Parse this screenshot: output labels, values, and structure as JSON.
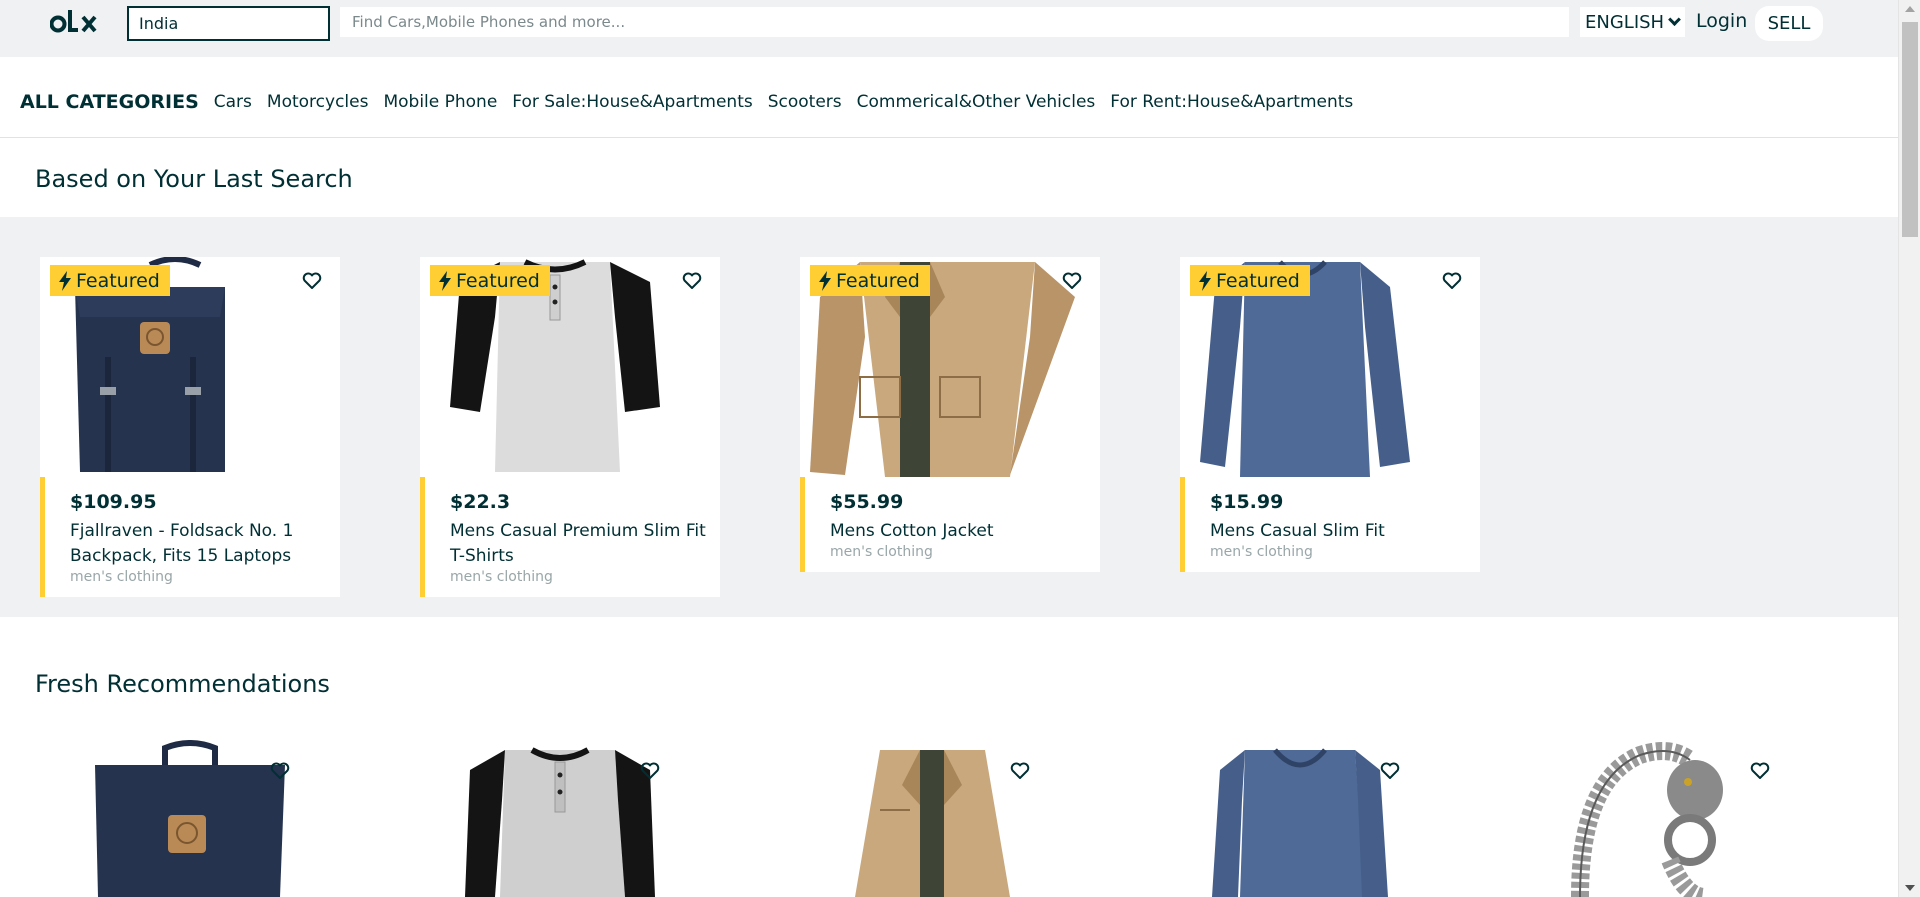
{
  "header": {
    "logo_text": "olx",
    "location_value": "India",
    "search_placeholder": "Find Cars,Mobile Phones and more...",
    "language": "ENGLISH",
    "login_label": "Login",
    "sell_label": "SELL"
  },
  "categories": {
    "all_label": "ALL CATEGORIES",
    "items": [
      "Cars",
      "Motorcycles",
      "Mobile Phone",
      "For Sale:House&Apartments",
      "Scooters",
      "Commerical&Other Vehicles",
      "For Rent:House&Apartments"
    ]
  },
  "last_search": {
    "title": "Based on Your Last Search",
    "badge_label": "Featured",
    "cards": [
      {
        "price": "$109.95",
        "name": "Fjallraven - Foldsack No. 1 Backpack, Fits 15 Laptops",
        "category": "men's clothing",
        "image": "backpack"
      },
      {
        "price": "$22.3",
        "name": "Mens Casual Premium Slim Fit T-Shirts",
        "category": "men's clothing",
        "image": "raglan-shirt"
      },
      {
        "price": "$55.99",
        "name": "Mens Cotton Jacket",
        "category": "men's clothing",
        "image": "jacket"
      },
      {
        "price": "$15.99",
        "name": "Mens Casual Slim Fit",
        "category": "men's clothing",
        "image": "long-sleeve-shirt"
      }
    ]
  },
  "fresh": {
    "title": "Fresh Recommendations",
    "items": [
      "backpack",
      "raglan-shirt",
      "jacket",
      "long-sleeve-shirt",
      "dragon-bracelet"
    ]
  },
  "colors": {
    "brand": "#002f34",
    "featured": "#ffce32",
    "band": "#eff1f3"
  }
}
